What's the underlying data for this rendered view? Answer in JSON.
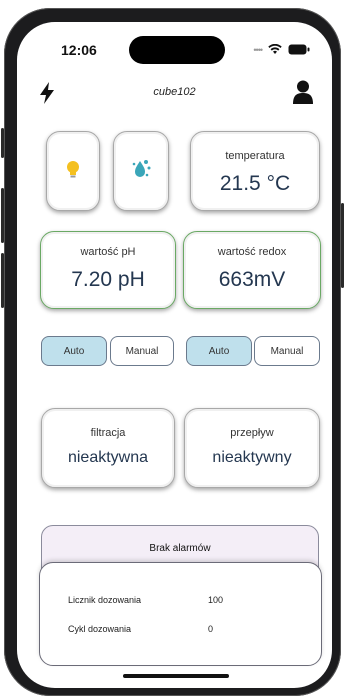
{
  "status_bar": {
    "time": "12:06"
  },
  "header": {
    "title": "cube102",
    "left_icon": "lightning-icon",
    "right_icon": "user-icon"
  },
  "tiles": {
    "light": {
      "icon": "lightbulb-icon",
      "color": "#f4c020"
    },
    "water": {
      "icon": "water-drop-icon",
      "color": "#3aa6b9"
    }
  },
  "temperature": {
    "label": "temperatura",
    "value": "21.5 °C"
  },
  "ph": {
    "label": "wartość pH",
    "value": "7.20 pH",
    "mode_auto": "Auto",
    "mode_manual": "Manual"
  },
  "redox": {
    "label": "wartość redox",
    "value": "663mV",
    "mode_auto": "Auto",
    "mode_manual": "Manual"
  },
  "filtration": {
    "label": "filtracja",
    "value": "nieaktywna"
  },
  "flow": {
    "label": "przepływ",
    "value": "nieaktywny"
  },
  "alarms": {
    "text": "Brak alarmów"
  },
  "dosing": {
    "counter_label": "Licznik dozowania",
    "counter_value": "100",
    "cycle_label": "Cykl dozowania",
    "cycle_value": "0"
  },
  "colors": {
    "accent_active": "#bfe0ec",
    "green_border": "#6aa964",
    "value_text": "#243750"
  }
}
